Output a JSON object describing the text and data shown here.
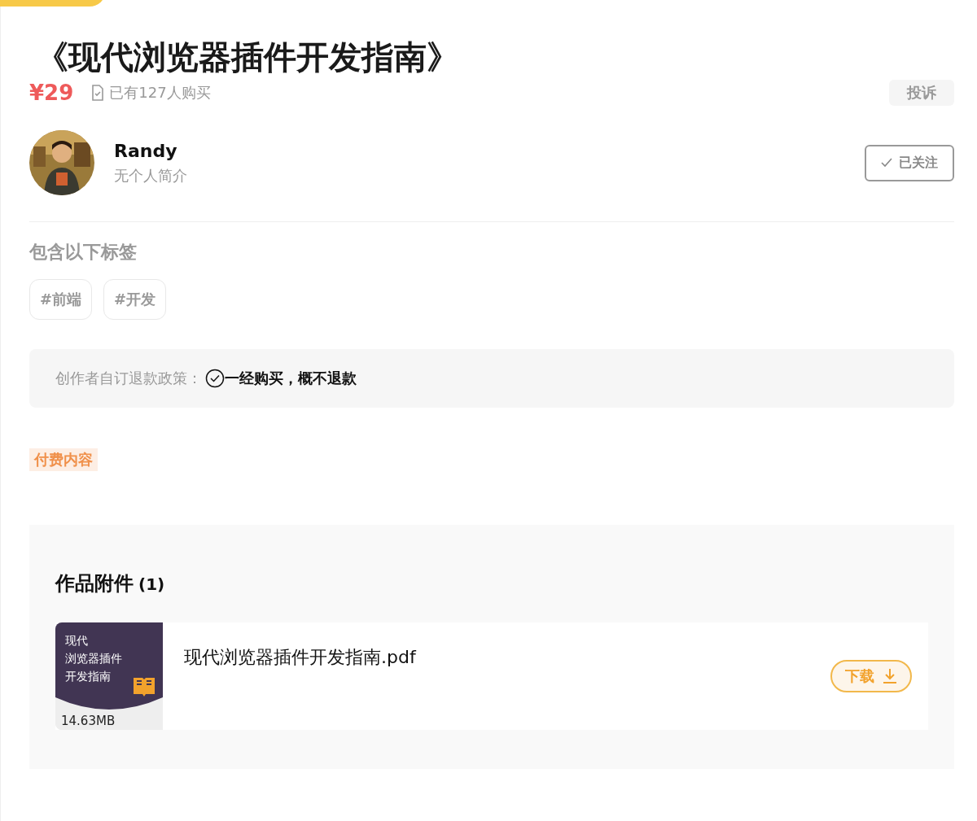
{
  "title": "《现代浏览器插件开发指南》",
  "price": "¥29",
  "purchases": "已有127人购买",
  "report_button": "投诉",
  "author": {
    "name": "Randy",
    "bio": "无个人简介"
  },
  "follow_button": {
    "label": "已关注",
    "followed": true
  },
  "tags_heading": "包含以下标签",
  "tags": [
    "#前端",
    "#开发"
  ],
  "refund_policy": {
    "label": "创作者自订退款政策：",
    "value": "一经购买，概不退款"
  },
  "paid_badge": "付费内容",
  "attachments": {
    "heading": "作品附件",
    "count": "(1)",
    "files": [
      {
        "thumb_lines": [
          "现代",
          "浏览器插件",
          "开发指南"
        ],
        "size": "14.63MB",
        "name": "现代浏览器插件开发指南.pdf",
        "download": "下载"
      }
    ]
  }
}
